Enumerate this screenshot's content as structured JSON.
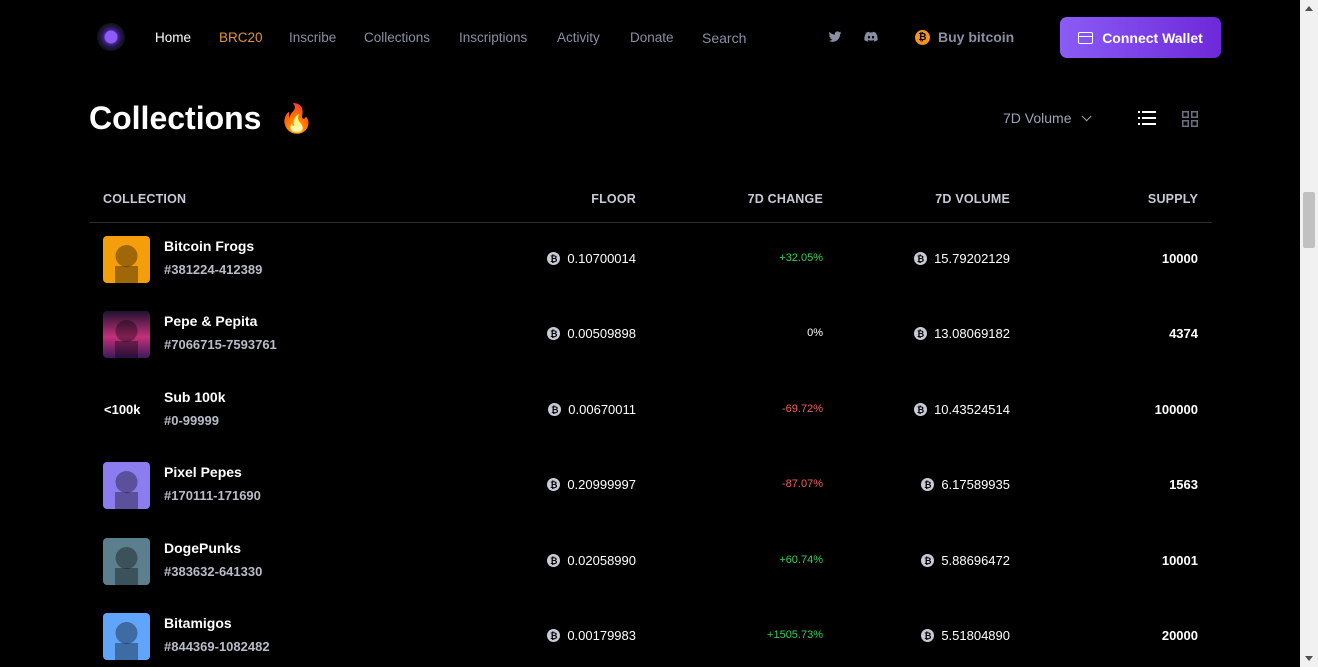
{
  "nav": {
    "links": [
      {
        "label": "Home",
        "active": true
      },
      {
        "label": "BRC20"
      },
      {
        "label": "Inscribe"
      },
      {
        "label": "Collections"
      },
      {
        "label": "Inscriptions"
      },
      {
        "label": "Activity"
      },
      {
        "label": "Donate"
      }
    ],
    "search_label": "Search",
    "social_icons": [
      "twitter-icon",
      "discord-icon"
    ],
    "buy_label": "Buy bitcoin",
    "connect_label": "Connect Wallet"
  },
  "page": {
    "title": "Collections",
    "title_emoji": "🔥",
    "sort_label": "7D Volume"
  },
  "table": {
    "headers": {
      "collection": "COLLECTION",
      "floor": "FLOOR",
      "change": "7D CHANGE",
      "volume": "7D VOLUME",
      "supply": "SUPPLY"
    },
    "rows": [
      {
        "name": "Bitcoin Frogs",
        "range": "#381224-412389",
        "floor": "0.10700014",
        "change": "+32.05%",
        "change_dir": "pos",
        "volume": "15.79202129",
        "supply": "10000",
        "thumb_label": ""
      },
      {
        "name": "Pepe & Pepita",
        "range": "#7066715-7593761",
        "floor": "0.00509898",
        "change": "0%",
        "change_dir": "neu",
        "volume": "13.08069182",
        "supply": "4374",
        "thumb_label": ""
      },
      {
        "name": "Sub 100k",
        "range": "#0-99999",
        "floor": "0.00670011",
        "change": "-69.72%",
        "change_dir": "neg",
        "volume": "10.43524514",
        "supply": "100000",
        "thumb_label": "<100k"
      },
      {
        "name": "Pixel Pepes",
        "range": "#170111-171690",
        "floor": "0.20999997",
        "change": "-87.07%",
        "change_dir": "neg",
        "volume": "6.17589935",
        "supply": "1563",
        "thumb_label": ""
      },
      {
        "name": "DogePunks",
        "range": "#383632-641330",
        "floor": "0.02058990",
        "change": "+60.74%",
        "change_dir": "pos",
        "volume": "5.88696472",
        "supply": "10001",
        "thumb_label": ""
      },
      {
        "name": "Bitamigos",
        "range": "#844369-1082482",
        "floor": "0.00179983",
        "change": "+1505.73%",
        "change_dir": "pos",
        "volume": "5.51804890",
        "supply": "20000",
        "thumb_label": ""
      }
    ]
  },
  "colors": {
    "accent": "#8b5cf6",
    "positive": "#34d058",
    "negative": "#f0605a",
    "brc20": "#e0913c",
    "bitcoin": "#f7931a"
  }
}
